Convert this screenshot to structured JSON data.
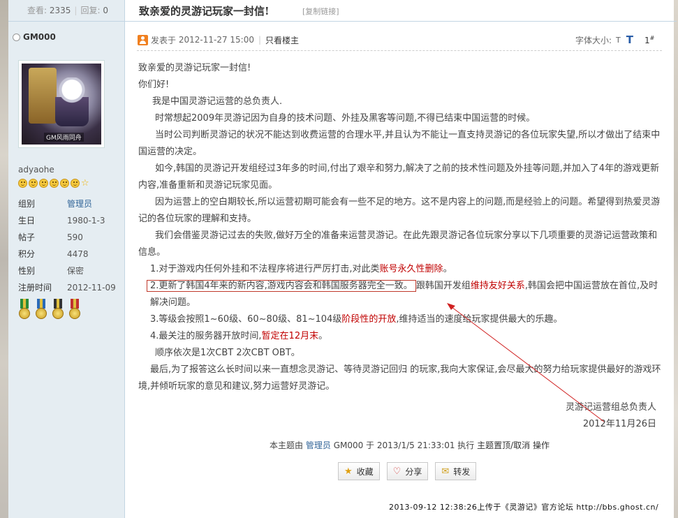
{
  "sidebar": {
    "views_label": "查看:",
    "views": "2335",
    "replies_label": "回复:",
    "replies": "0",
    "author": "GM000",
    "avatar_caption": "GM风雨同舟",
    "username": "adyaohe",
    "profile": [
      {
        "key": "组别",
        "value": "管理员"
      },
      {
        "key": "生日",
        "value": "1980-1-3"
      },
      {
        "key": "帖子",
        "value": "590"
      },
      {
        "key": "积分",
        "value": "4478"
      },
      {
        "key": "性别",
        "value": "保密"
      },
      {
        "key": "注册时间",
        "value": "2012-11-09"
      }
    ]
  },
  "header": {
    "title": "致亲爱的灵游记玩家一封信!",
    "copy_link": "[复制链接]"
  },
  "meta": {
    "posted_label": "发表于",
    "posted_time": "2012-11-27 15:00",
    "only_author": "只看楼主",
    "font_size_label": "字体大小:",
    "font_small": "T",
    "font_large": "T",
    "floor": "1",
    "floor_mark": "#"
  },
  "post": {
    "p1": "致亲爱的灵游记玩家一封信!",
    "p2": "你们好!",
    "p3": "我是中国灵游记运营的总负责人.",
    "p4": "时常想起2009年灵游记因为自身的技术问题、外挂及黑客等问题,不得已结束中国运营的时候。",
    "p5": "当时公司判断灵游记的状况不能达到收费运营的合理水平,并且认为不能让一直支持灵游记的各位玩家失望,所以才做出了结束中国运营的决定。",
    "p6": "如今,韩国的灵游记开发组经过3年多的时间,付出了艰辛和努力,解决了之前的技术性问题及外挂等问题,并加入了4年的游戏更新内容,准备重新和灵游记玩家见面。",
    "p7": "因为运营上的空白期较长,所以运营初期可能会有一些不足的地方。这不是内容上的问题,而是经验上的问题。希望得到热爱灵游记的各位玩家的理解和支持。",
    "p8": "我们会借鉴灵游记过去的失败,做好万全的准备来运营灵游记。在此先跟灵游记各位玩家分享以下几项重要的灵游记运营政策和信息。",
    "item1_a": "1.对于游戏内任何外挂和不法程序将进行严厉打击,对此类",
    "item1_red": "账号永久性删除",
    "item1_b": "。",
    "item2_boxed": "2.更新了韩国4年来的新内容,游戏内容会和韩国服务器完全一致。",
    "item2_a": "跟韩国开发组",
    "item2_red": "维持友好关系",
    "item2_b": ",韩国会把中国运营放在首位,及时解决问题。",
    "item3_a": "3.等级会按照1~60级、60~80级、81~104级",
    "item3_red": "阶段性的开放",
    "item3_b": ",维持适当的速度给玩家提供最大的乐趣。",
    "item4_a": "4.最关注的服务器开放时间,",
    "item4_red": "暂定在12月末",
    "item4_b": "。",
    "item5": "顺序依次是1次CBT 2次CBT OBT。",
    "p_last": "最后,为了报答这么长时间以来一直想念灵游记、等待灵游记回归 的玩家,我向大家保证,会尽最大的努力给玩家提供最好的游戏环境,并倾听玩家的意见和建议,努力运营好灵游记。",
    "signature": "灵游记运营组总负责人",
    "sign_date": "2012年11月26日"
  },
  "footer": {
    "prefix": "本主题由",
    "role": "管理员",
    "middle": "GM000 于 2013/1/5 21:33:01 执行",
    "action": "主题置顶/取消",
    "op": "操作"
  },
  "actions": {
    "favorite": "收藏",
    "share": "分享",
    "forward": "转发"
  },
  "watermark": "2013-09-12 12:38:26上传于《灵游记》官方论坛 http://bbs.ghost.cn/",
  "colors": {
    "accent_red": "#c00000",
    "link_blue": "#336699",
    "sidebar_bg": "#e5edf2",
    "arrow_red": "#d02020"
  }
}
